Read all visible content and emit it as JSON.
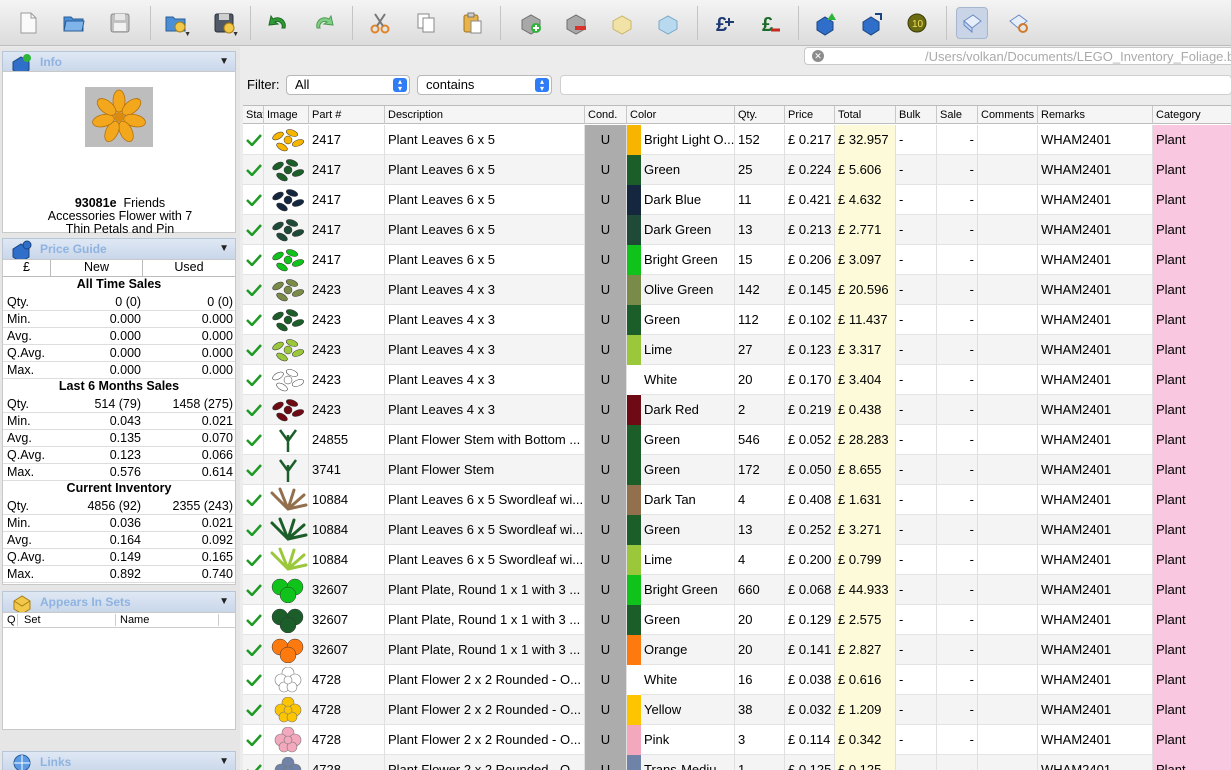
{
  "toolbar": {
    "buttons": [
      "new-document",
      "open-folder",
      "save",
      "import-folder",
      "save-as",
      "undo",
      "redo",
      "cut",
      "copy",
      "paste",
      "add-item",
      "remove-item",
      "merge-items",
      "split-items",
      "price-adjust",
      "price-increase",
      "upload-store",
      "upload-other",
      "mass-update",
      "view-mode",
      "view-mode-alt"
    ]
  },
  "path": {
    "value": "/Users/volkan/Documents/LEGO_Inventory_Foliage.bsx"
  },
  "filter": {
    "label": "Filter:",
    "field": "All",
    "operator": "contains",
    "value": ""
  },
  "sidebar": {
    "info": {
      "title": "Info",
      "part_id": "93081e",
      "part_line1_rest": "Friends",
      "part_line2": "Accessories Flower with 7",
      "part_line3": "Thin Petals and Pin"
    },
    "price_guide": {
      "title": "Price Guide",
      "currency": "£",
      "col_new": "New",
      "col_used": "Used",
      "sections": [
        {
          "title": "All Time Sales",
          "rows": [
            {
              "label": "Qty.",
              "new": "0 (0)",
              "used": "0 (0)"
            },
            {
              "label": "Min.",
              "new": "0.000",
              "used": "0.000"
            },
            {
              "label": "Avg.",
              "new": "0.000",
              "used": "0.000"
            },
            {
              "label": "Q.Avg.",
              "new": "0.000",
              "used": "0.000"
            },
            {
              "label": "Max.",
              "new": "0.000",
              "used": "0.000"
            }
          ]
        },
        {
          "title": "Last 6 Months Sales",
          "rows": [
            {
              "label": "Qty.",
              "new": "514 (79)",
              "used": "1458 (275)"
            },
            {
              "label": "Min.",
              "new": "0.043",
              "used": "0.021"
            },
            {
              "label": "Avg.",
              "new": "0.135",
              "used": "0.070"
            },
            {
              "label": "Q.Avg.",
              "new": "0.123",
              "used": "0.066"
            },
            {
              "label": "Max.",
              "new": "0.576",
              "used": "0.614"
            }
          ]
        },
        {
          "title": "Current Inventory",
          "rows": [
            {
              "label": "Qty.",
              "new": "4856 (92)",
              "used": "2355 (243)"
            },
            {
              "label": "Min.",
              "new": "0.036",
              "used": "0.021"
            },
            {
              "label": "Avg.",
              "new": "0.164",
              "used": "0.092"
            },
            {
              "label": "Q.Avg.",
              "new": "0.149",
              "used": "0.165"
            },
            {
              "label": "Max.",
              "new": "0.892",
              "used": "0.740"
            }
          ]
        }
      ]
    },
    "appears_in_sets": {
      "title": "Appears In Sets",
      "col_q": "Q",
      "col_set": "Set",
      "col_name": "Name"
    },
    "links": {
      "title": "Links"
    }
  },
  "table": {
    "columns": [
      "Status",
      "Image",
      "Part #",
      "Description",
      "Cond.",
      "Color",
      "Qty.",
      "Price",
      "Total",
      "Bulk",
      "Sale",
      "Comments",
      "Remarks",
      "Category"
    ],
    "rows": [
      {
        "part": "2417",
        "desc": "Plant Leaves 6 x 5",
        "cond": "U",
        "color": "Bright Light O...",
        "swatch": "#f7b500",
        "qty": "152",
        "price": "£ 0.217",
        "total": "£ 32.957",
        "bulk": "-",
        "sale": "-",
        "comments": "",
        "remarks": "WHAM2401",
        "category": "Plant"
      },
      {
        "part": "2417",
        "desc": "Plant Leaves 6 x 5",
        "cond": "U",
        "color": "Green",
        "swatch": "#1b5e2a",
        "qty": "25",
        "price": "£ 0.224",
        "total": "£ 5.606",
        "bulk": "-",
        "sale": "-",
        "comments": "",
        "remarks": "WHAM2401",
        "category": "Plant"
      },
      {
        "part": "2417",
        "desc": "Plant Leaves 6 x 5",
        "cond": "U",
        "color": "Dark Blue",
        "swatch": "#14273f",
        "qty": "11",
        "price": "£ 0.421",
        "total": "£ 4.632",
        "bulk": "-",
        "sale": "-",
        "comments": "",
        "remarks": "WHAM2401",
        "category": "Plant"
      },
      {
        "part": "2417",
        "desc": "Plant Leaves 6 x 5",
        "cond": "U",
        "color": "Dark Green",
        "swatch": "#1f4a38",
        "qty": "13",
        "price": "£ 0.213",
        "total": "£ 2.771",
        "bulk": "-",
        "sale": "-",
        "comments": "",
        "remarks": "WHAM2401",
        "category": "Plant"
      },
      {
        "part": "2417",
        "desc": "Plant Leaves 6 x 5",
        "cond": "U",
        "color": "Bright Green",
        "swatch": "#10c31a",
        "qty": "15",
        "price": "£ 0.206",
        "total": "£ 3.097",
        "bulk": "-",
        "sale": "-",
        "comments": "",
        "remarks": "WHAM2401",
        "category": "Plant"
      },
      {
        "part": "2423",
        "desc": "Plant Leaves 4 x 3",
        "cond": "U",
        "color": "Olive Green",
        "swatch": "#7a8a49",
        "qty": "142",
        "price": "£ 0.145",
        "total": "£ 20.596",
        "bulk": "-",
        "sale": "-",
        "comments": "",
        "remarks": "WHAM2401",
        "category": "Plant"
      },
      {
        "part": "2423",
        "desc": "Plant Leaves 4 x 3",
        "cond": "U",
        "color": "Green",
        "swatch": "#1b5e2a",
        "qty": "112",
        "price": "£ 0.102",
        "total": "£ 11.437",
        "bulk": "-",
        "sale": "-",
        "comments": "",
        "remarks": "WHAM2401",
        "category": "Plant"
      },
      {
        "part": "2423",
        "desc": "Plant Leaves 4 x 3",
        "cond": "U",
        "color": "Lime",
        "swatch": "#9bc83a",
        "qty": "27",
        "price": "£ 0.123",
        "total": "£ 3.317",
        "bulk": "-",
        "sale": "-",
        "comments": "",
        "remarks": "WHAM2401",
        "category": "Plant"
      },
      {
        "part": "2423",
        "desc": "Plant Leaves 4 x 3",
        "cond": "U",
        "color": "White",
        "swatch": "#ffffff",
        "qty": "20",
        "price": "£ 0.170",
        "total": "£ 3.404",
        "bulk": "-",
        "sale": "-",
        "comments": "",
        "remarks": "WHAM2401",
        "category": "Plant"
      },
      {
        "part": "2423",
        "desc": "Plant Leaves 4 x 3",
        "cond": "U",
        "color": "Dark Red",
        "swatch": "#6e0a14",
        "qty": "2",
        "price": "£ 0.219",
        "total": "£ 0.438",
        "bulk": "-",
        "sale": "-",
        "comments": "",
        "remarks": "WHAM2401",
        "category": "Plant"
      },
      {
        "part": "24855",
        "desc": "Plant Flower Stem with Bottom ...",
        "cond": "U",
        "color": "Green",
        "swatch": "#1b5e2a",
        "qty": "546",
        "price": "£ 0.052",
        "total": "£ 28.283",
        "bulk": "-",
        "sale": "-",
        "comments": "",
        "remarks": "WHAM2401",
        "category": "Plant"
      },
      {
        "part": "3741",
        "desc": "Plant Flower Stem",
        "cond": "U",
        "color": "Green",
        "swatch": "#1b5e2a",
        "qty": "172",
        "price": "£ 0.050",
        "total": "£ 8.655",
        "bulk": "-",
        "sale": "-",
        "comments": "",
        "remarks": "WHAM2401",
        "category": "Plant"
      },
      {
        "part": "10884",
        "desc": "Plant Leaves 6 x 5 Swordleaf wi...",
        "cond": "U",
        "color": "Dark Tan",
        "swatch": "#92704d",
        "qty": "4",
        "price": "£ 0.408",
        "total": "£ 1.631",
        "bulk": "-",
        "sale": "-",
        "comments": "",
        "remarks": "WHAM2401",
        "category": "Plant"
      },
      {
        "part": "10884",
        "desc": "Plant Leaves 6 x 5 Swordleaf wi...",
        "cond": "U",
        "color": "Green",
        "swatch": "#1b5e2a",
        "qty": "13",
        "price": "£ 0.252",
        "total": "£ 3.271",
        "bulk": "-",
        "sale": "-",
        "comments": "",
        "remarks": "WHAM2401",
        "category": "Plant"
      },
      {
        "part": "10884",
        "desc": "Plant Leaves 6 x 5 Swordleaf wi...",
        "cond": "U",
        "color": "Lime",
        "swatch": "#9bc83a",
        "qty": "4",
        "price": "£ 0.200",
        "total": "£ 0.799",
        "bulk": "-",
        "sale": "-",
        "comments": "",
        "remarks": "WHAM2401",
        "category": "Plant"
      },
      {
        "part": "32607",
        "desc": "Plant Plate, Round 1 x 1 with 3 ...",
        "cond": "U",
        "color": "Bright Green",
        "swatch": "#10c31a",
        "qty": "660",
        "price": "£ 0.068",
        "total": "£ 44.933",
        "bulk": "-",
        "sale": "-",
        "comments": "",
        "remarks": "WHAM2401",
        "category": "Plant"
      },
      {
        "part": "32607",
        "desc": "Plant Plate, Round 1 x 1 with 3 ...",
        "cond": "U",
        "color": "Green",
        "swatch": "#1b5e2a",
        "qty": "20",
        "price": "£ 0.129",
        "total": "£ 2.575",
        "bulk": "-",
        "sale": "-",
        "comments": "",
        "remarks": "WHAM2401",
        "category": "Plant"
      },
      {
        "part": "32607",
        "desc": "Plant Plate, Round 1 x 1 with 3 ...",
        "cond": "U",
        "color": "Orange",
        "swatch": "#fe7a0e",
        "qty": "20",
        "price": "£ 0.141",
        "total": "£ 2.827",
        "bulk": "-",
        "sale": "-",
        "comments": "",
        "remarks": "WHAM2401",
        "category": "Plant"
      },
      {
        "part": "4728",
        "desc": "Plant Flower 2 x 2 Rounded - O...",
        "cond": "U",
        "color": "White",
        "swatch": "#ffffff",
        "qty": "16",
        "price": "£ 0.038",
        "total": "£ 0.616",
        "bulk": "-",
        "sale": "-",
        "comments": "",
        "remarks": "WHAM2401",
        "category": "Plant"
      },
      {
        "part": "4728",
        "desc": "Plant Flower 2 x 2 Rounded - O...",
        "cond": "U",
        "color": "Yellow",
        "swatch": "#fdc500",
        "qty": "38",
        "price": "£ 0.032",
        "total": "£ 1.209",
        "bulk": "-",
        "sale": "-",
        "comments": "",
        "remarks": "WHAM2401",
        "category": "Plant"
      },
      {
        "part": "4728",
        "desc": "Plant Flower 2 x 2 Rounded - O...",
        "cond": "U",
        "color": "Pink",
        "swatch": "#f4a8bd",
        "qty": "3",
        "price": "£ 0.114",
        "total": "£ 0.342",
        "bulk": "-",
        "sale": "-",
        "comments": "",
        "remarks": "WHAM2401",
        "category": "Plant"
      },
      {
        "part": "4728",
        "desc": "Plant Flower 2 x 2 Rounded - O...",
        "cond": "U",
        "color": "Trans-Mediu...",
        "swatch": "#6f83a8",
        "qty": "1",
        "price": "£ 0.125",
        "total": "£ 0.125",
        "bulk": "-",
        "sale": "-",
        "comments": "",
        "remarks": "WHAM2401",
        "category": "Plant"
      }
    ]
  }
}
